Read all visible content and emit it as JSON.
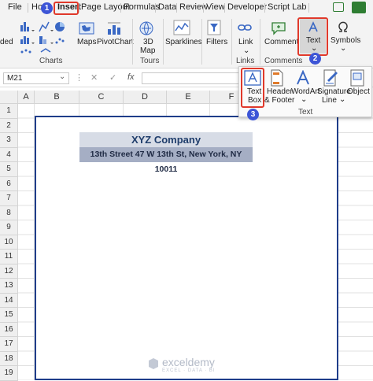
{
  "menu": {
    "file": "File",
    "home": "Ho",
    "insert": "Insert",
    "page_layout": "Page Layout",
    "formulas": "Formulas",
    "data": "Data",
    "review": "Review",
    "view": "View",
    "developer": "Developer",
    "script_lab": "Script Lab"
  },
  "ribbon": {
    "ded": "ded",
    "maps": "Maps",
    "pivotchart": "PivotChart",
    "map3d_1": "3D",
    "map3d_2": "Map",
    "sparklines": "Sparklines",
    "filters": "Filters",
    "link": "Link",
    "comment": "Comment",
    "text": "Text",
    "symbols": "Symbols",
    "group_charts": "Charts",
    "group_tours": "Tours",
    "group_links": "Links",
    "group_comments": "Comments"
  },
  "dropdown": {
    "textbox_1": "Text",
    "textbox_2": "Box",
    "header_1": "Header",
    "header_2": "& Footer",
    "wordart": "WordArt",
    "signature_1": "Signature",
    "signature_2": "Line",
    "object": "Object",
    "group": "Text"
  },
  "formula_bar": {
    "name_box": "M21",
    "fx": "fx"
  },
  "columns": [
    "A",
    "B",
    "C",
    "D",
    "E",
    "F"
  ],
  "rows": [
    "1",
    "2",
    "3",
    "4",
    "5",
    "6",
    "7",
    "8",
    "9",
    "10",
    "11",
    "12",
    "13",
    "14",
    "15",
    "16",
    "17",
    "18",
    "19"
  ],
  "sheet": {
    "company": "XYZ Company",
    "address": "13th Street 47 W 13th St, New York, NY 10011"
  },
  "watermark": {
    "name": "exceldemy",
    "tagline": "EXCEL · DATA · BI"
  },
  "badges": [
    "1",
    "2",
    "3"
  ],
  "colors": {
    "accent_red": "#e0392b",
    "badge_blue": "#3d55d6",
    "title_band": "#d7dce6",
    "address_band": "#a5aec4",
    "page_border": "#1f3d8a"
  }
}
